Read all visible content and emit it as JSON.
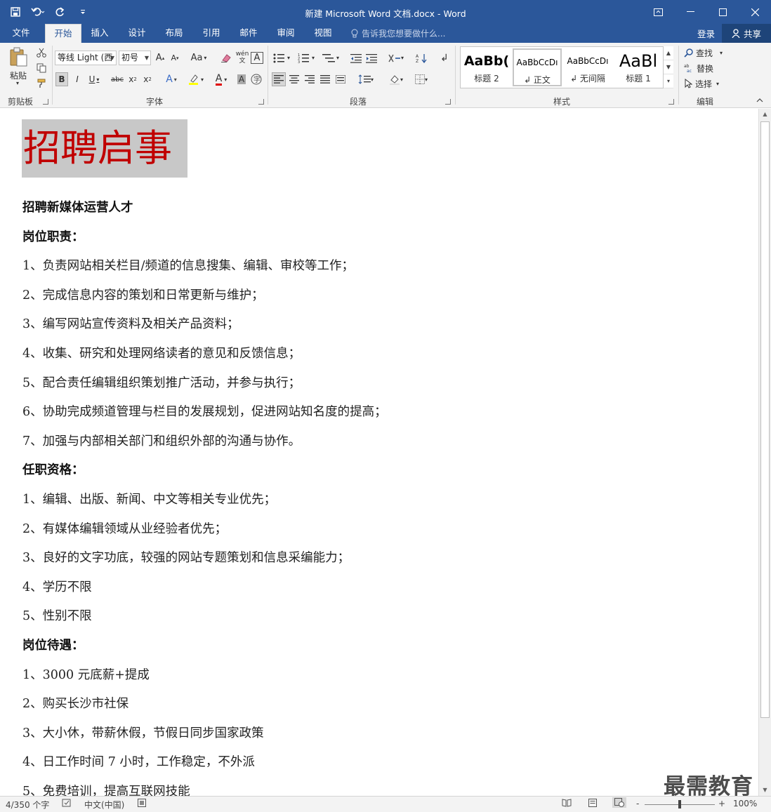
{
  "window": {
    "title": "新建 Microsoft Word 文档.docx - Word",
    "quick_access": [
      "save-icon",
      "undo-icon",
      "redo-icon",
      "customize-icon"
    ],
    "controls": [
      "ribbon-display-icon",
      "minimize-icon",
      "maximize-icon",
      "close-icon"
    ]
  },
  "tabs": {
    "file": "文件",
    "home": "开始",
    "insert": "插入",
    "design": "设计",
    "layout": "布局",
    "references": "引用",
    "mailings": "邮件",
    "review": "审阅",
    "view": "视图",
    "tell_me": "告诉我您想要做什么...",
    "login": "登录",
    "share": "共享"
  },
  "ribbon": {
    "clipboard": {
      "label": "剪贴板",
      "paste": "粘贴"
    },
    "font": {
      "label": "字体",
      "font_name": "等线 Light (西",
      "font_size": "初号",
      "change_case": "Aa",
      "phonetic": "wén\n文",
      "char_border": "A"
    },
    "paragraph": {
      "label": "段落"
    },
    "styles": {
      "label": "样式",
      "items": [
        {
          "sample": "AaBb(",
          "name": "标题 2"
        },
        {
          "sample": "AaBbCcDı",
          "name": "↲ 正文"
        },
        {
          "sample": "AaBbCcDı",
          "name": "↲ 无间隔"
        },
        {
          "sample": "AaBl",
          "name": "标题 1"
        }
      ]
    },
    "editing": {
      "label": "编辑",
      "find": "查找",
      "replace": "替换",
      "select": "选择"
    }
  },
  "document": {
    "heading": "招聘启事",
    "lines": [
      {
        "text": "招聘新媒体运营人才",
        "bold": true
      },
      {
        "text": "岗位职责：",
        "bold": true
      },
      {
        "text": "1、负责网站相关栏目/频道的信息搜集、编辑、审校等工作；",
        "bold": false
      },
      {
        "text": "2、完成信息内容的策划和日常更新与维护；",
        "bold": false
      },
      {
        "text": "3、编写网站宣传资料及相关产品资料；",
        "bold": false
      },
      {
        "text": "4、收集、研究和处理网络读者的意见和反馈信息；",
        "bold": false
      },
      {
        "text": "5、配合责任编辑组织策划推广活动，并参与执行；",
        "bold": false
      },
      {
        "text": "6、协助完成频道管理与栏目的发展规划，促进网站知名度的提高；",
        "bold": false
      },
      {
        "text": "7、加强与内部相关部门和组织外部的沟通与协作。",
        "bold": false
      },
      {
        "text": "任职资格：",
        "bold": true
      },
      {
        "text": "1、编辑、出版、新闻、中文等相关专业优先；",
        "bold": false
      },
      {
        "text": "2、有媒体编辑领域从业经验者优先；",
        "bold": false
      },
      {
        "text": "3、良好的文字功底，较强的网站专题策划和信息采编能力；",
        "bold": false
      },
      {
        "text": "4、学历不限",
        "bold": false
      },
      {
        "text": "5、性别不限",
        "bold": false
      },
      {
        "text": "岗位待遇：",
        "bold": true
      },
      {
        "text": "1、3000 元底薪+提成",
        "bold": false
      },
      {
        "text": "2、购买长沙市社保",
        "bold": false
      },
      {
        "text": "3、大小休，带薪休假，节假日同步国家政策",
        "bold": false
      },
      {
        "text": "4、日工作时间 7 小时，工作稳定，不外派",
        "bold": false
      },
      {
        "text": "5、免费培训，提高互联网技能",
        "bold": false
      }
    ]
  },
  "watermark": "最需教育",
  "statusbar": {
    "word_count": "4/350 个字",
    "language": "中文(中国)",
    "zoom": "100%",
    "zoom_minus": "-",
    "zoom_plus": "+"
  },
  "colors": {
    "title_bar": "#2b579a",
    "heading_text": "#c00000",
    "heading_highlight": "#c8c8c8",
    "ribbon_bg": "#f3f3f3"
  }
}
